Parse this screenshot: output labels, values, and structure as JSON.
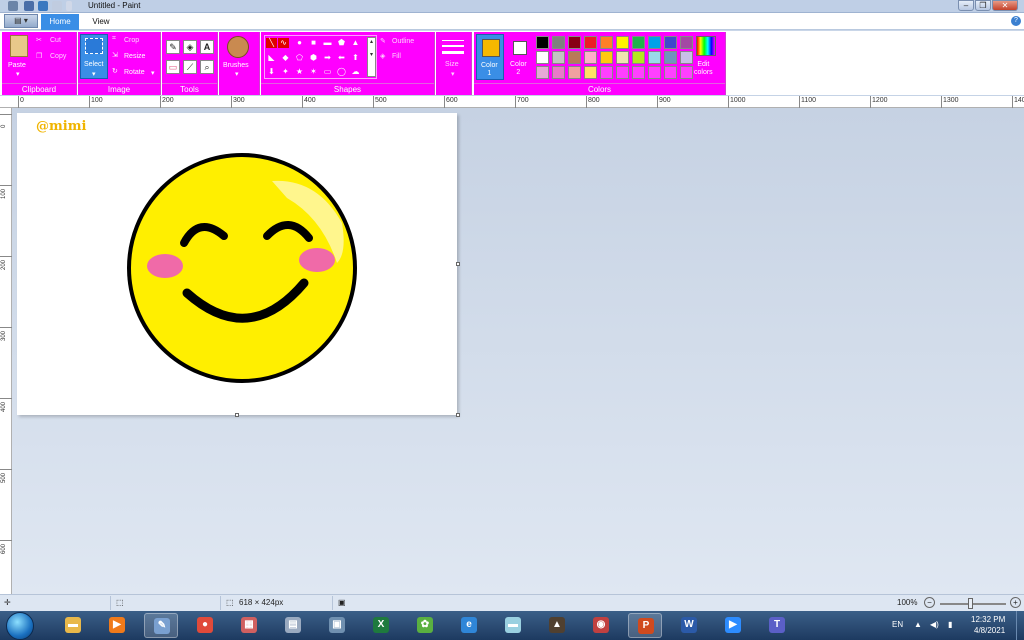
{
  "window": {
    "title": "Untitled - Paint"
  },
  "tabs": {
    "home": "Home",
    "view": "View"
  },
  "ribbon": {
    "clipboard": {
      "label": "Clipboard",
      "paste": "Paste",
      "cut": "Cut",
      "copy": "Copy"
    },
    "image": {
      "label": "Image",
      "select": "Select",
      "crop": "Crop",
      "resize": "Resize",
      "rotate": "Rotate"
    },
    "tools": {
      "label": "Tools"
    },
    "brushes": {
      "label": "Brushes"
    },
    "shapes": {
      "label": "Shapes",
      "outline": "Outline",
      "fill": "Fill"
    },
    "size": {
      "label": "Size"
    },
    "colors": {
      "label": "Colors",
      "color1": "Color\n1",
      "color2": "Color\n2",
      "edit": "Edit\ncolors",
      "color1_value": "#f5b800",
      "color2_value": "#ffffff",
      "palette_row1": [
        "#000000",
        "#7f7f7f",
        "#880015",
        "#ed1c24",
        "#ff7f27",
        "#fff200",
        "#22b14c",
        "#00a2e8",
        "#3f48cc",
        "#a349a4"
      ],
      "palette_row2": [
        "#ffffff",
        "#c3c3c3",
        "#b97a57",
        "#ffaec9",
        "#ffc90e",
        "#efe4b0",
        "#b5e61d",
        "#99d9ea",
        "#7092be",
        "#c8bfe7"
      ],
      "palette_row3": [
        "#e6a8d7",
        "#e879c8",
        "#f0a0a0",
        "#ffe066",
        "#ff40ff",
        "#ff40ff",
        "#ff40ff",
        "#ff40ff",
        "#ff40ff",
        "#ff40ff"
      ]
    }
  },
  "ruler": {
    "top": [
      "0",
      "100",
      "200",
      "300",
      "400",
      "500",
      "600",
      "700",
      "800",
      "900",
      "1000",
      "1100",
      "1200",
      "1300",
      "140"
    ],
    "left": [
      "0",
      "100",
      "200",
      "300",
      "400",
      "500",
      "600"
    ]
  },
  "canvas": {
    "watermark": "@mimi"
  },
  "status": {
    "size": "618 × 424px",
    "zoom": "100%"
  },
  "tray": {
    "lang": "EN",
    "time": "12:32 PM",
    "date": "4/8/2021"
  },
  "taskbar": {
    "apps": [
      {
        "name": "explorer",
        "glyph": "▬",
        "color": "#e8b84a"
      },
      {
        "name": "media",
        "glyph": "▶",
        "color": "#f07a1a"
      },
      {
        "name": "paint",
        "glyph": "✎",
        "color": "#7aa0d0"
      },
      {
        "name": "chrome",
        "glyph": "●",
        "color": "#e04a3a"
      },
      {
        "name": "app5",
        "glyph": "▦",
        "color": "#d06060"
      },
      {
        "name": "app6",
        "glyph": "▤",
        "color": "#9aaac0"
      },
      {
        "name": "app7",
        "glyph": "▣",
        "color": "#7090b0"
      },
      {
        "name": "excel",
        "glyph": "X",
        "color": "#1e7a3e"
      },
      {
        "name": "app9",
        "glyph": "✿",
        "color": "#5ab040"
      },
      {
        "name": "ie",
        "glyph": "e",
        "color": "#2f86d8"
      },
      {
        "name": "folder",
        "glyph": "▬",
        "color": "#9ad0e0"
      },
      {
        "name": "mic",
        "glyph": "▲",
        "color": "#504030"
      },
      {
        "name": "app13",
        "glyph": "◉",
        "color": "#c04040"
      },
      {
        "name": "powerpoint",
        "glyph": "P",
        "color": "#d04a1e"
      },
      {
        "name": "word",
        "glyph": "W",
        "color": "#2b5aa8"
      },
      {
        "name": "zoom",
        "glyph": "▶",
        "color": "#2d8cff"
      },
      {
        "name": "teams",
        "glyph": "T",
        "color": "#5b5fc7"
      }
    ]
  }
}
